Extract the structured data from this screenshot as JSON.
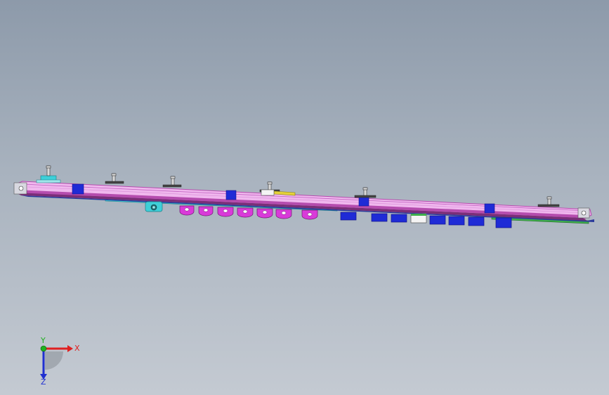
{
  "viewport": {
    "background_top": "#8d9aaa",
    "background_bottom": "#c4cad2"
  },
  "model": {
    "colors": {
      "main_beam": "#f0b8ee",
      "beam_edge": "#b54cae",
      "beam_dark": "#7a2e78",
      "block_blue": "#1f2bd6",
      "block_dark_blue": "#13148a",
      "rail_cyan": "#3ecfd8",
      "rail_green": "#3fae4b",
      "lug_magenta": "#d93ad9",
      "white_block": "#f4f4f4",
      "yellow_part": "#e4d23a",
      "pin_gray": "#d8d8d8"
    }
  },
  "triad": {
    "x_label": "X",
    "y_label": "Y",
    "z_label": "Z",
    "x_color": "#e02020",
    "y_color": "#20b020",
    "z_color": "#2030d0"
  }
}
